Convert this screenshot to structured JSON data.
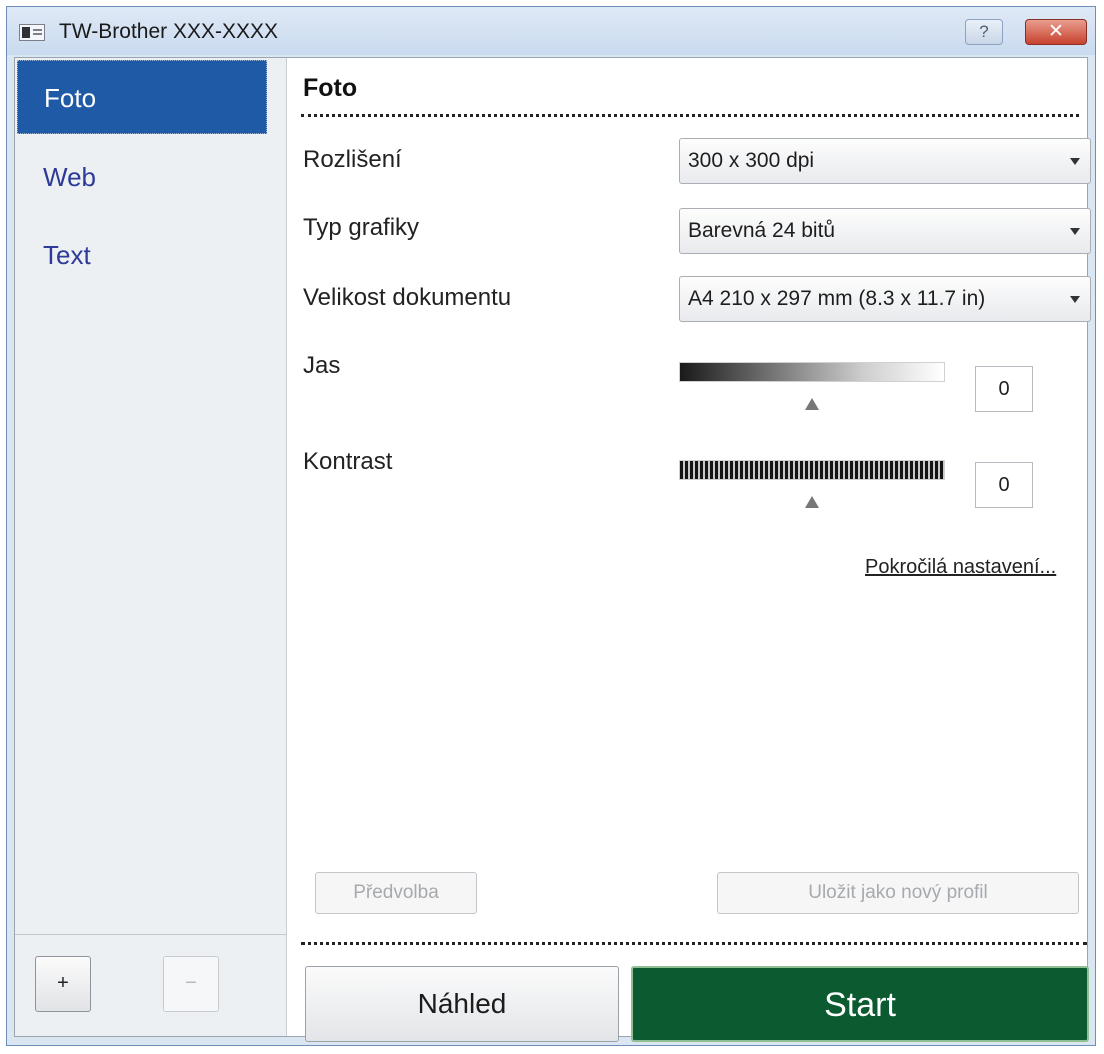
{
  "window": {
    "title": "TW-Brother XXX-XXXX",
    "help_label": "?",
    "close_label": "✕"
  },
  "sidebar": {
    "items": [
      {
        "label": "Foto",
        "selected": true
      },
      {
        "label": "Web",
        "selected": false
      },
      {
        "label": "Text",
        "selected": false
      }
    ],
    "add_label": "+",
    "remove_label": "−"
  },
  "main": {
    "section_title": "Foto",
    "resolution": {
      "label": "Rozlišení",
      "value": "300 x 300 dpi"
    },
    "color_type": {
      "label": "Typ grafiky",
      "value": "Barevná 24 bitů"
    },
    "doc_size": {
      "label": "Velikost dokumentu",
      "value": "A4 210 x 297 mm (8.3 x 11.7 in)"
    },
    "brightness": {
      "label": "Jas",
      "value": "0",
      "slider_level": 0.5
    },
    "contrast": {
      "label": "Kontrast",
      "value": "0",
      "slider_level": 0.5
    },
    "advanced_link": "Pokročilá nastavení...",
    "preset_button": "Předvolba",
    "save_profile_button": "Uložit jako nový profil",
    "preview_button": "Náhled",
    "start_button": "Start"
  },
  "colors": {
    "selected_bg": "#1f5aa6",
    "start_bg": "#0c5a2f",
    "sidebar_link": "#2e3a98"
  }
}
